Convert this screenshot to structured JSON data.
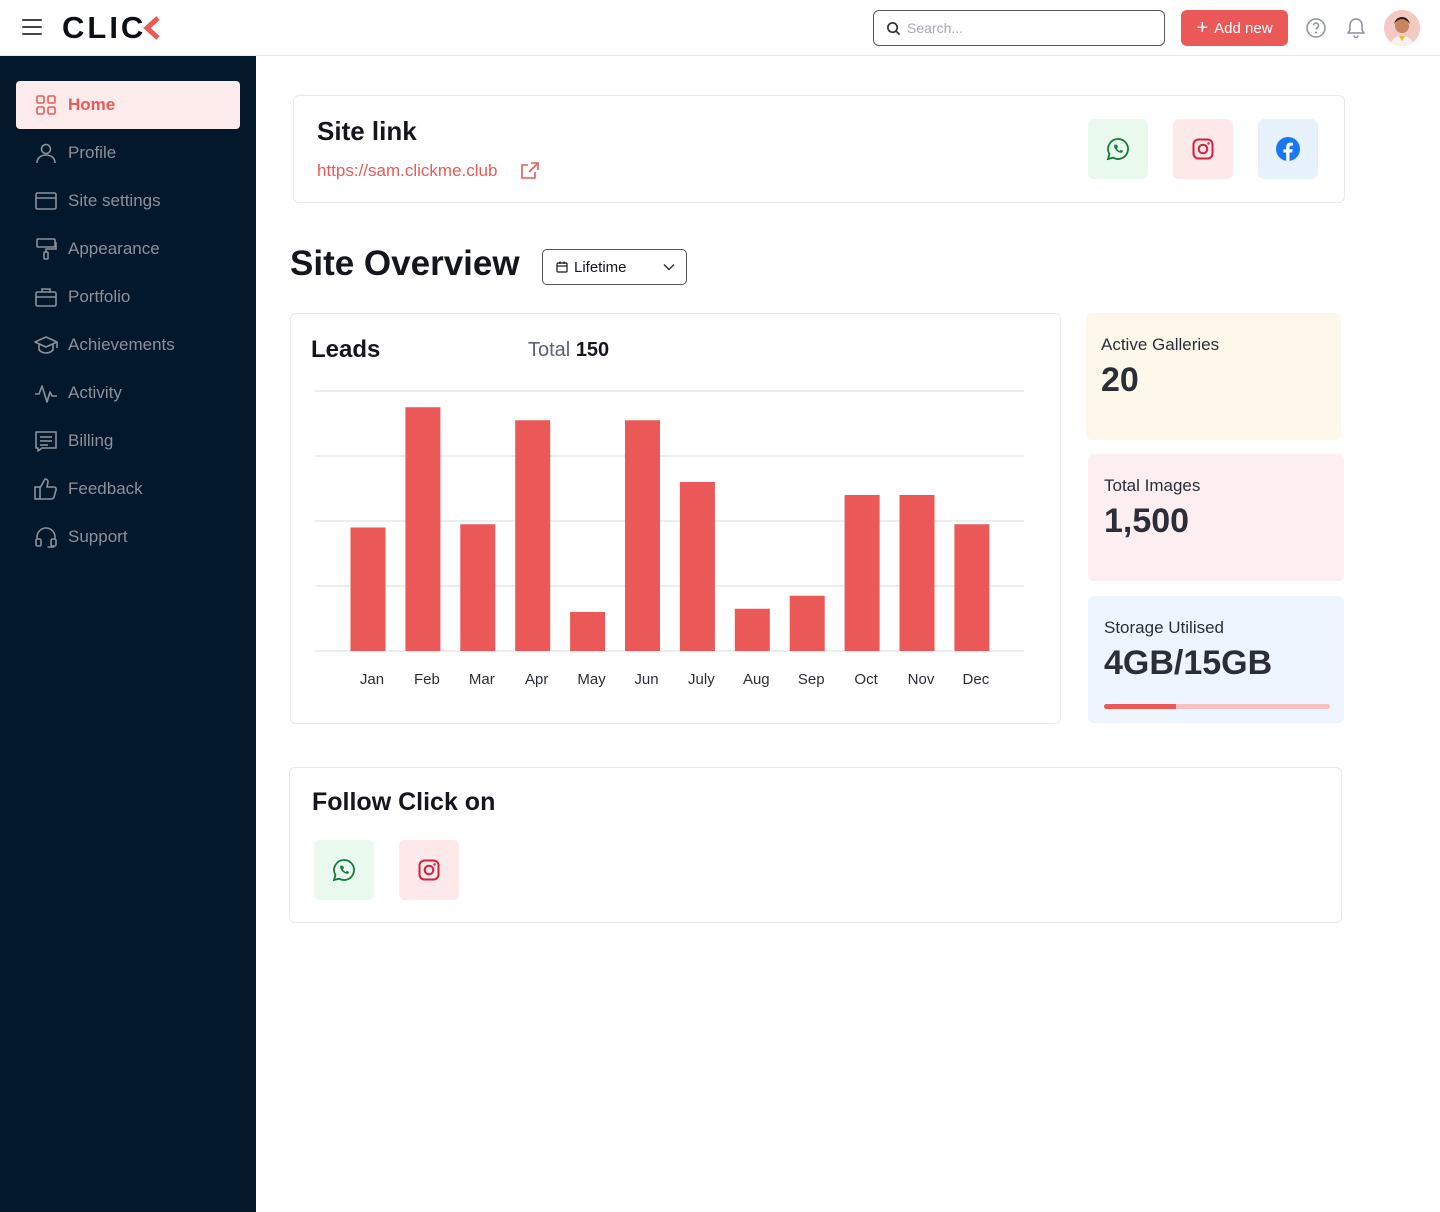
{
  "header": {
    "logo_text": "CLIC",
    "search_placeholder": "Search...",
    "add_new_label": "Add new"
  },
  "sidebar": {
    "items": [
      {
        "label": "Home",
        "icon": "grid-icon",
        "active": true
      },
      {
        "label": "Profile",
        "icon": "user-icon"
      },
      {
        "label": "Site settings",
        "icon": "browser-icon"
      },
      {
        "label": "Appearance",
        "icon": "paint-roller-icon"
      },
      {
        "label": "Portfolio",
        "icon": "briefcase-icon"
      },
      {
        "label": "Achievements",
        "icon": "graduation-cap-icon"
      },
      {
        "label": "Activity",
        "icon": "activity-icon"
      },
      {
        "label": "Billing",
        "icon": "receipt-icon"
      },
      {
        "label": "Feedback",
        "icon": "thumbs-up-icon"
      },
      {
        "label": "Support",
        "icon": "headset-icon"
      }
    ]
  },
  "site_link": {
    "title": "Site link",
    "url": "https://sam.clickme.club",
    "socials": [
      "whatsapp-icon",
      "instagram-icon",
      "facebook-icon"
    ]
  },
  "overview": {
    "title": "Site Overview",
    "period": "Lifetime"
  },
  "leads": {
    "title": "Leads",
    "total_label": "Total",
    "total_value": "150"
  },
  "stats": {
    "galleries": {
      "label": "Active Galleries",
      "value": "20"
    },
    "images": {
      "label": "Total Images",
      "value": "1,500"
    },
    "storage": {
      "label": "Storage Utilised",
      "value": "4GB/15GB",
      "used_fraction": 0.32
    }
  },
  "follow": {
    "title": "Follow Click on",
    "socials": [
      "whatsapp-icon",
      "instagram-icon"
    ]
  },
  "colors": {
    "accent": "#ea5957",
    "sidebar_bg": "#03182b"
  },
  "chart_data": {
    "type": "bar",
    "categories": [
      "Jan",
      "Feb",
      "Mar",
      "Apr",
      "May",
      "Jun",
      "July",
      "Aug",
      "Sep",
      "Oct",
      "Nov",
      "Dec"
    ],
    "values": [
      38,
      75,
      39,
      71,
      12,
      71,
      52,
      13,
      17,
      48,
      48,
      39
    ],
    "ylim": [
      0,
      80
    ],
    "grid": true,
    "color": "#ea5957"
  }
}
